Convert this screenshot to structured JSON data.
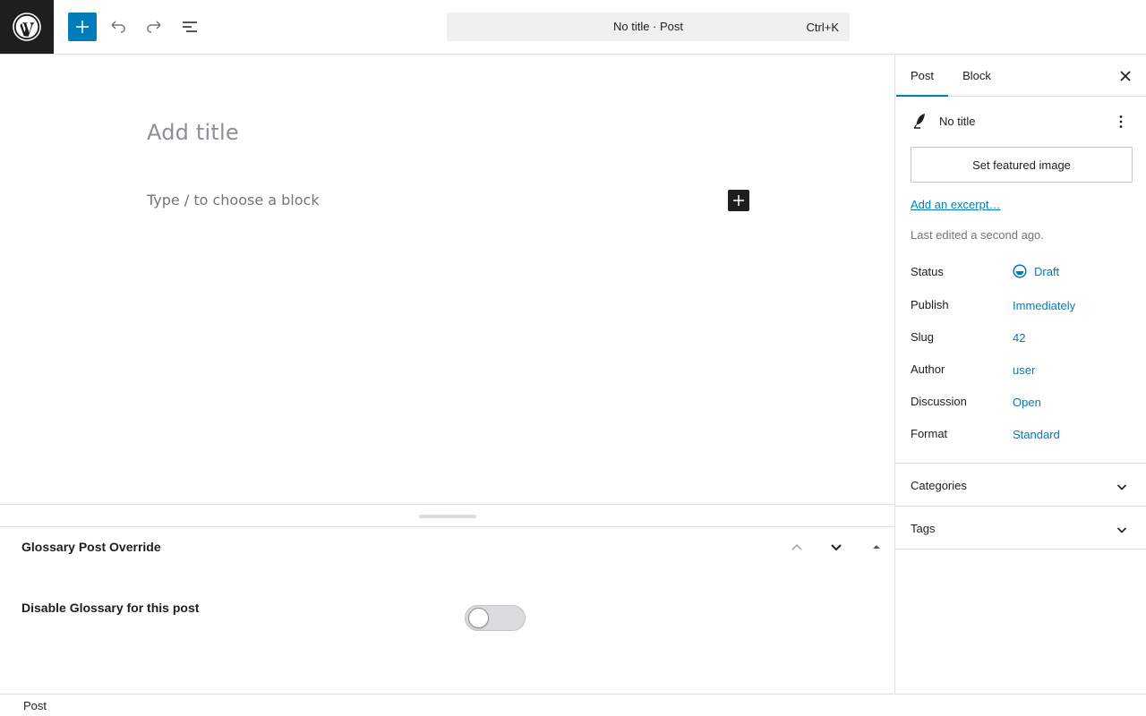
{
  "header": {
    "logo_icon": "wordpress-logo-icon",
    "inserter_icon": "plus-icon",
    "undo_icon": "undo-icon",
    "redo_icon": "redo-icon",
    "document_overview_icon": "list-view-icon",
    "command_bar": {
      "title": "No title · Post",
      "shortcut": "Ctrl+K"
    }
  },
  "editor": {
    "title_placeholder": "Add title",
    "block_placeholder": "Type / to choose a block",
    "block_inserter_icon": "plus-icon"
  },
  "metabox": {
    "title": "Glossary Post Override",
    "field_label": "Disable Glossary for this post",
    "toggle_on": false
  },
  "footer": {
    "breadcrumb": "Post"
  },
  "sidebar": {
    "tabs": [
      {
        "label": "Post",
        "active": true
      },
      {
        "label": "Block",
        "active": false
      }
    ],
    "close_icon": "close-icon",
    "post_card": {
      "icon": "feather-pen-icon",
      "title": "No title",
      "menu_icon": "more-vertical-icon"
    },
    "featured_image_label": "Set featured image",
    "excerpt_link": "Add an excerpt…",
    "last_edited": "Last edited a second ago.",
    "properties": [
      {
        "label": "Status",
        "value": "Draft"
      },
      {
        "label": "Publish",
        "value": "Immediately"
      },
      {
        "label": "Slug",
        "value": "42"
      },
      {
        "label": "Author",
        "value": "user"
      },
      {
        "label": "Discussion",
        "value": "Open"
      },
      {
        "label": "Format",
        "value": "Standard"
      }
    ],
    "panels": [
      {
        "title": "Categories"
      },
      {
        "title": "Tags"
      }
    ]
  },
  "colors": {
    "accent": "#007cba",
    "dark": "#1e1e1e",
    "border": "#e0e0e0",
    "muted": "#757575"
  }
}
